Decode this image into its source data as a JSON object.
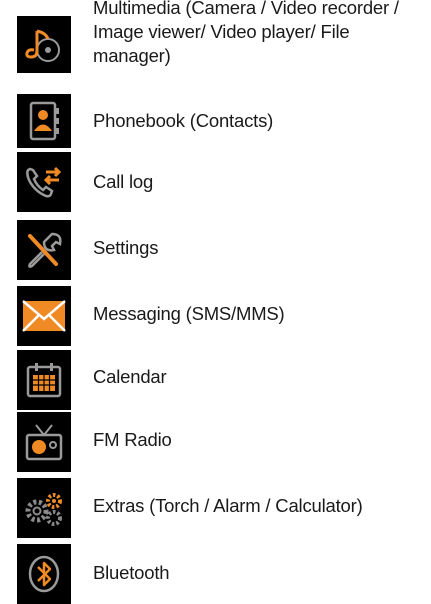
{
  "items": [
    {
      "icon": "multimedia-icon",
      "label_lines": [
        "Multimedia (Camera / Video recorder /",
        "Image viewer/ Video player/ File",
        "manager)"
      ]
    },
    {
      "icon": "phonebook-icon",
      "label": "Phonebook (Contacts)"
    },
    {
      "icon": "call-log-icon",
      "label": "Call log"
    },
    {
      "icon": "settings-icon",
      "label": "Settings"
    },
    {
      "icon": "messaging-icon",
      "label": "Messaging (SMS/MMS)"
    },
    {
      "icon": "calendar-icon",
      "label": "Calendar"
    },
    {
      "icon": "fm-radio-icon",
      "label": "FM Radio"
    },
    {
      "icon": "extras-icon",
      "label": "Extras (Torch / Alarm / Calculator)"
    },
    {
      "icon": "bluetooth-icon",
      "label": "Bluetooth"
    }
  ],
  "colors": {
    "accent": "#f08a24",
    "icon_bg": "#000000",
    "grey": "#9a9a9a"
  }
}
